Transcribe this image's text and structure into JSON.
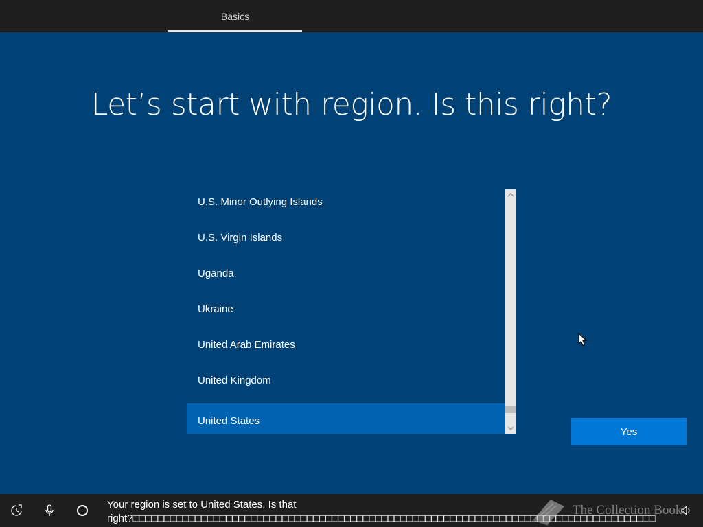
{
  "topbar": {
    "tab_label": "Basics"
  },
  "main": {
    "title": "Let’s start with region. Is this right?",
    "regions": [
      "U.S. Minor Outlying Islands",
      "U.S. Virgin Islands",
      "Uganda",
      "Ukraine",
      "United Arab Emirates",
      "United Kingdom",
      "United States"
    ],
    "selected_region": "United States",
    "yes_label": "Yes"
  },
  "bottombar": {
    "icons": [
      "ease-of-access-icon",
      "microphone-icon",
      "cortana-icon",
      "volume-icon"
    ],
    "caption_line1": "Your region is set to United States. Is that",
    "caption_line2": "right?□□□□□□□□□□□□□□□□□□□□□□□□□□□□□□□□□□□□□□□□□□□□□□□□□□□□□□□□□□□□□□□□□□□□□□□□□□□□□□□□□□□□",
    "watermark": "The Collection Book"
  },
  "colors": {
    "background": "#004275",
    "selection": "#0063b1",
    "button": "#0078d7",
    "bar": "#1f1f1f"
  }
}
